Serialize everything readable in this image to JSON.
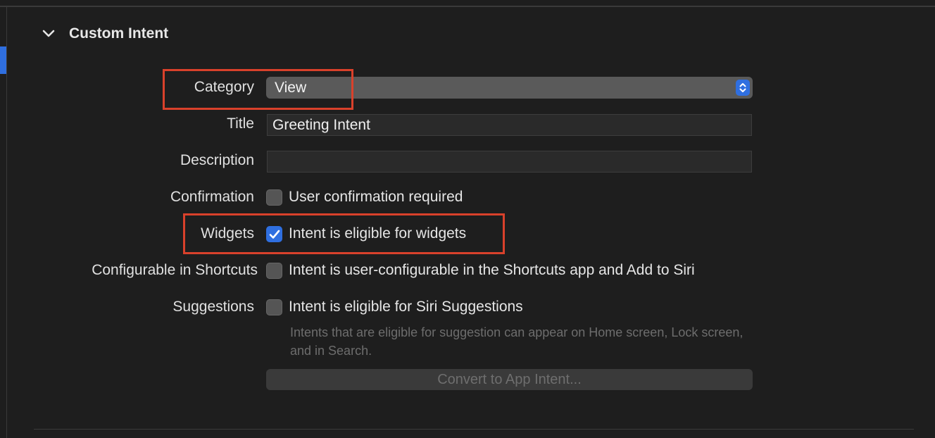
{
  "section": {
    "title": "Custom Intent",
    "chevron_icon": "chevron-down-icon"
  },
  "fields": {
    "category": {
      "label": "Category",
      "value": "View"
    },
    "title": {
      "label": "Title",
      "value": "Greeting Intent"
    },
    "description": {
      "label": "Description",
      "value": ""
    },
    "confirmation": {
      "label": "Confirmation",
      "checkbox_label": "User confirmation required",
      "checked": false
    },
    "widgets": {
      "label": "Widgets",
      "checkbox_label": "Intent is eligible for widgets",
      "checked": true
    },
    "configurable": {
      "label": "Configurable in Shortcuts",
      "checkbox_label": "Intent is user-configurable in the Shortcuts app and Add to Siri",
      "checked": false
    },
    "suggestions": {
      "label": "Suggestions",
      "checkbox_label": "Intent is eligible for Siri Suggestions",
      "checked": false,
      "help_text": "Intents that are eligible for suggestion can appear on Home screen, Lock screen, and in Search."
    }
  },
  "convert_button": {
    "label": "Convert to App Intent..."
  },
  "colors": {
    "accent": "#2f6fe0",
    "highlight": "#d9412b",
    "background": "#1e1e1e"
  }
}
